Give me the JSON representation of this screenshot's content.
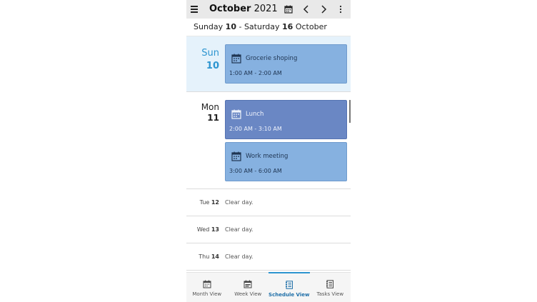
{
  "header": {
    "month": "October",
    "year": "2021"
  },
  "range": {
    "start_day": "Sunday",
    "start_num": "10",
    "separator": " - ",
    "end_day": "Saturday",
    "end_num": "16",
    "end_month": " October"
  },
  "days": [
    {
      "dow": "Sun",
      "num": "10",
      "events": [
        {
          "name": "Grocerie shoping",
          "time": "1:00 AM - 2:00 AM"
        }
      ]
    },
    {
      "dow": "Mon",
      "num": "11",
      "events": [
        {
          "name": "Lunch",
          "time": "2:00 AM - 3:10 AM"
        },
        {
          "name": "Work meeting",
          "time": "3:00 AM - 6:00 AM"
        }
      ]
    }
  ],
  "clear_days": [
    {
      "dow": "Tue",
      "num": "12",
      "text": "Clear day."
    },
    {
      "dow": "Wed",
      "num": "13",
      "text": "Clear day."
    },
    {
      "dow": "Thu",
      "num": "14",
      "text": "Clear day."
    }
  ],
  "tabs": [
    {
      "label": "Month View",
      "icon": "calendar-month-icon"
    },
    {
      "label": "Week View",
      "icon": "calendar-week-icon"
    },
    {
      "label": "Schedule View",
      "icon": "schedule-list-icon",
      "active": true
    },
    {
      "label": "Tasks View",
      "icon": "tasks-list-icon"
    }
  ],
  "colors": {
    "accent": "#2d95d0",
    "event": "#86b1e0",
    "event_selected": "#6a87c4",
    "today_bg": "#e5f2fb"
  }
}
